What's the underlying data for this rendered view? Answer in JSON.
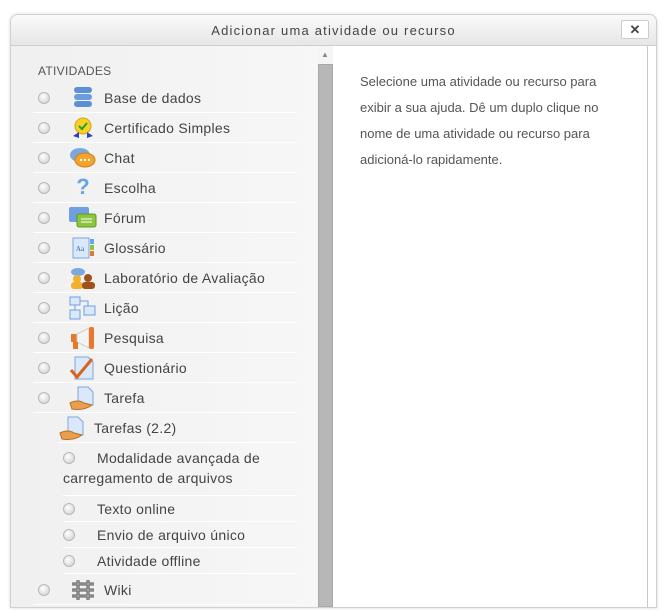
{
  "dialog": {
    "title": "Adicionar uma atividade ou recurso",
    "close_label": "✕"
  },
  "options": {
    "section_label": "ATIVIDADES",
    "items": [
      {
        "label": "Base de dados",
        "icon": "database-icon"
      },
      {
        "label": "Certificado Simples",
        "icon": "certificate-icon"
      },
      {
        "label": "Chat",
        "icon": "chat-icon"
      },
      {
        "label": "Escolha",
        "icon": "question-mark-icon"
      },
      {
        "label": "Fórum",
        "icon": "forum-icon"
      },
      {
        "label": "Glossário",
        "icon": "glossary-icon"
      },
      {
        "label": "Laboratório de Avaliação",
        "icon": "workshop-icon"
      },
      {
        "label": "Lição",
        "icon": "lesson-icon"
      },
      {
        "label": "Pesquisa",
        "icon": "megaphone-icon"
      },
      {
        "label": "Questionário",
        "icon": "quiz-icon"
      },
      {
        "label": "Tarefa",
        "icon": "assignment-icon"
      }
    ],
    "group": {
      "label": "Tarefas (2.2)",
      "icon": "assignment-icon",
      "subitems": [
        {
          "label_line1": "Modalidade avançada de",
          "label_line2": "carregamento de arquivos"
        },
        {
          "label_line1": "Texto online"
        },
        {
          "label_line1": "Envio de arquivo único"
        },
        {
          "label_line1": "Atividade offline"
        }
      ]
    },
    "last_item": {
      "label": "Wiki",
      "icon": "wiki-icon"
    }
  },
  "help": {
    "text": "Selecione uma atividade ou recurso para exibir a sua ajuda. Dê um duplo clique no nome de uma atividade ou recurso para adicioná-lo rapidamente."
  }
}
